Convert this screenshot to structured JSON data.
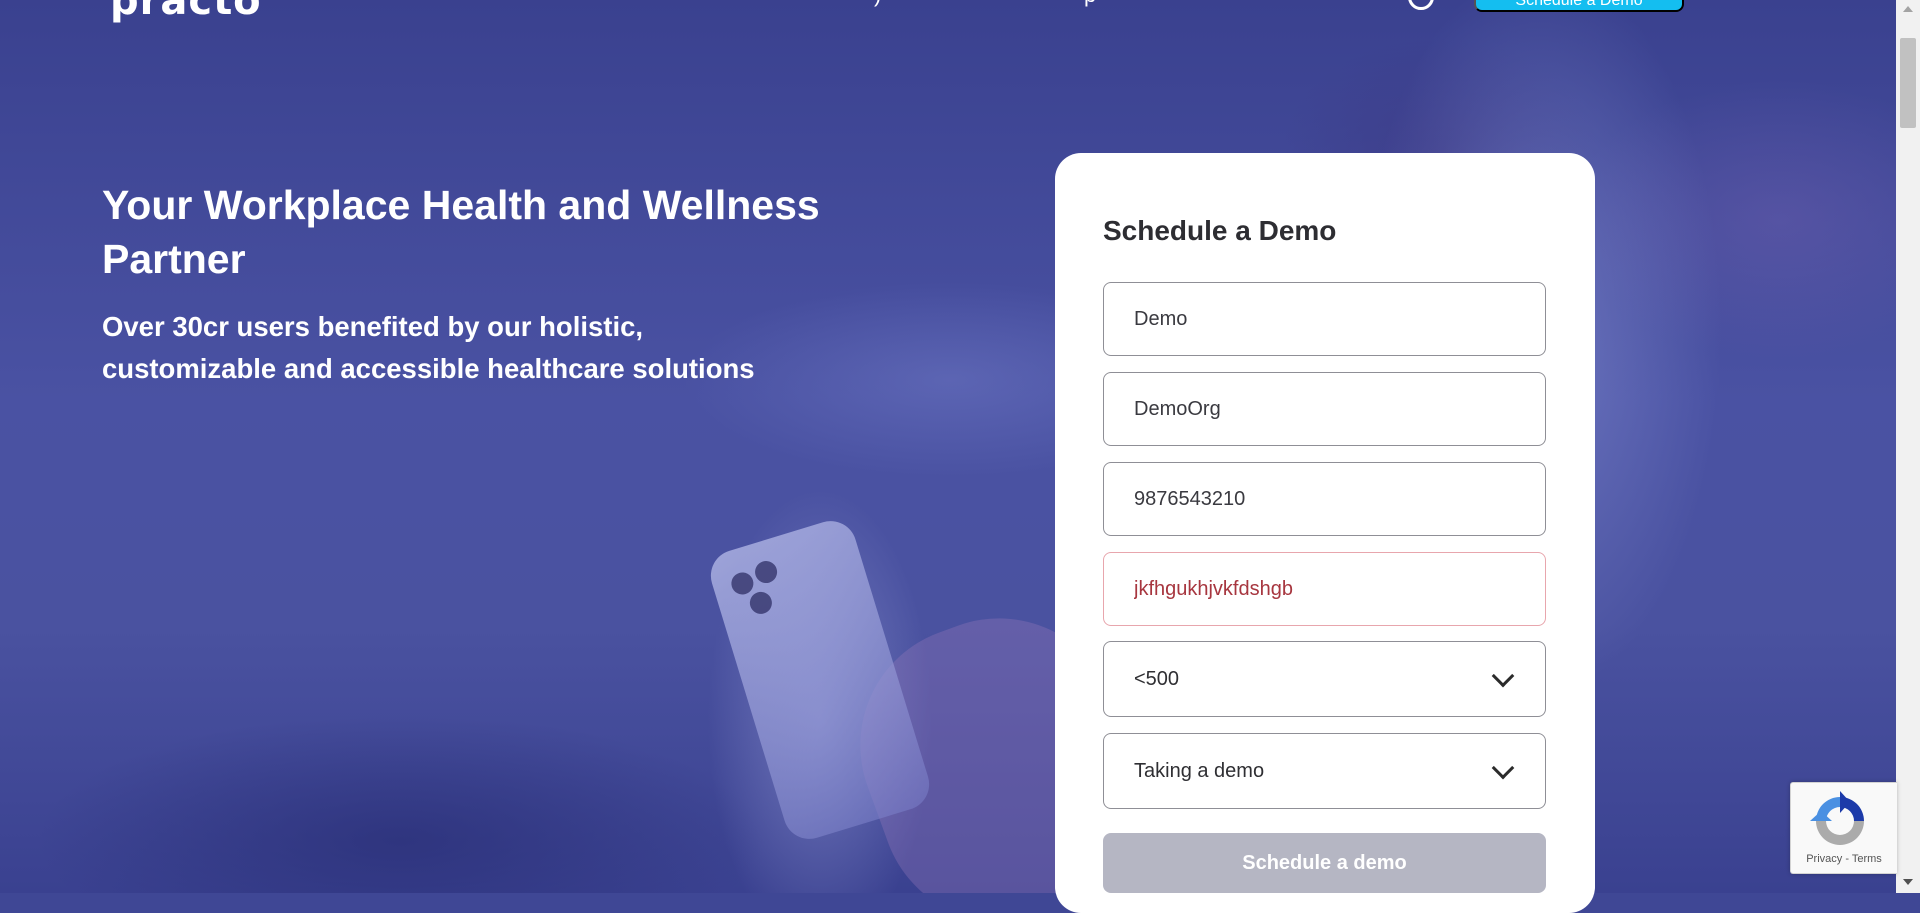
{
  "header": {
    "logo": "practo",
    "nav": [
      {
        "label": ")"
      },
      {
        "label": "p"
      }
    ],
    "cta_label": "Schedule a Demo"
  },
  "hero": {
    "title": "Your Workplace Health and Wellness Partner",
    "subtitle": "Over 30cr users benefited by our holistic, customizable and accessible healthcare solutions"
  },
  "form": {
    "title": "Schedule a Demo",
    "fields": {
      "name": "Demo",
      "organization": "DemoOrg",
      "phone": "9876543210",
      "email": "jkfhgukhjvkfdshgb"
    },
    "company_size": "<500",
    "interest": "Taking a demo",
    "submit_label": "Schedule a demo"
  },
  "recaptcha": {
    "privacy": "Privacy",
    "separator": "-",
    "terms": "Terms"
  },
  "colors": {
    "hero_overlay": "#3f4795",
    "cta": "#14bef0",
    "error_border": "#e8a6ad",
    "error_text": "#a7363f",
    "disabled_button": "#b5b6c3"
  }
}
